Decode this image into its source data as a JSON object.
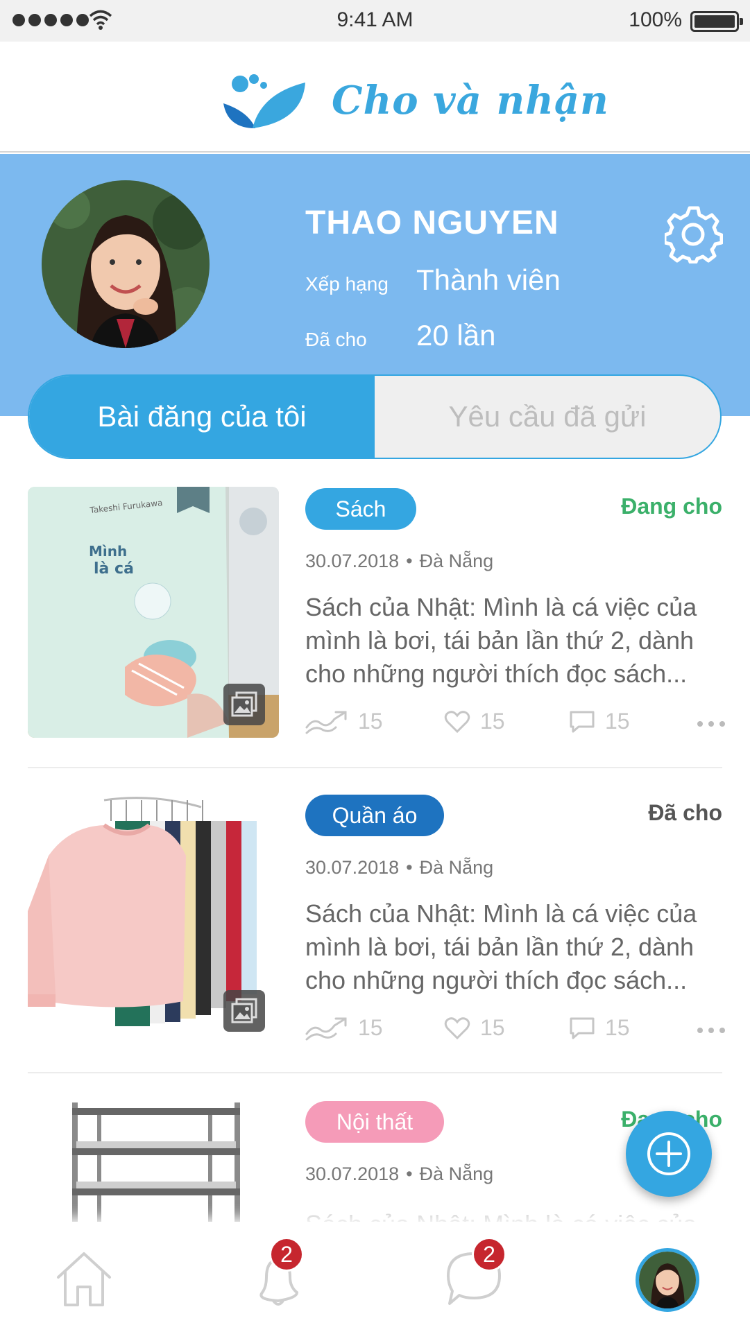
{
  "status_bar": {
    "time": "9:41 AM",
    "battery": "100%",
    "icons": [
      "signal-icon",
      "wifi-icon",
      "battery-icon"
    ]
  },
  "header": {
    "brand": "Cho và nhận",
    "logo_icon": "leaf-logo-icon"
  },
  "profile": {
    "name": "THAO NGUYEN",
    "rank_label": "Xếp hạng",
    "rank_value": "Thành viên",
    "given_label": "Đã cho",
    "given_value": "20 lần",
    "settings_icon": "gear-icon"
  },
  "tabs": [
    {
      "label": "Bài đăng của tôi",
      "active": true
    },
    {
      "label": "Yêu cầu đã gửi",
      "active": false
    }
  ],
  "posts": [
    {
      "category": "Sách",
      "category_color": "#34a6e1",
      "status": "Đang cho",
      "status_color": "#3bb06a",
      "date": "30.07.2018",
      "location": "Đà Nẵng",
      "description": "Sách của Nhật: Mình là cá việc của mình là bơi, tái bản lần thứ 2, dành cho những người thích đọc sách...",
      "shares": "15",
      "likes": "15",
      "comments": "15"
    },
    {
      "category": "Quần áo",
      "category_color": "#1e73c0",
      "status": "Đã cho",
      "status_color": "#555555",
      "date": "30.07.2018",
      "location": "Đà Nẵng",
      "description": "Sách của Nhật: Mình là cá việc của mình là bơi, tái bản lần thứ 2, dành cho những người thích đọc sách...",
      "shares": "15",
      "likes": "15",
      "comments": "15"
    },
    {
      "category": "Nội thất",
      "category_color": "#f59bb8",
      "status": "Đang cho",
      "status_color": "#3bb06a",
      "date": "30.07.2018",
      "location": "Đà Nẵng",
      "description": "Sách của Nhật: Mình là cá việc của"
    }
  ],
  "bottom_nav": {
    "notifications_badge": "2",
    "messages_badge": "2"
  },
  "colors": {
    "accent": "#34a6e1",
    "profile_bg": "#7cb9ef",
    "badge": "#c6262e"
  }
}
